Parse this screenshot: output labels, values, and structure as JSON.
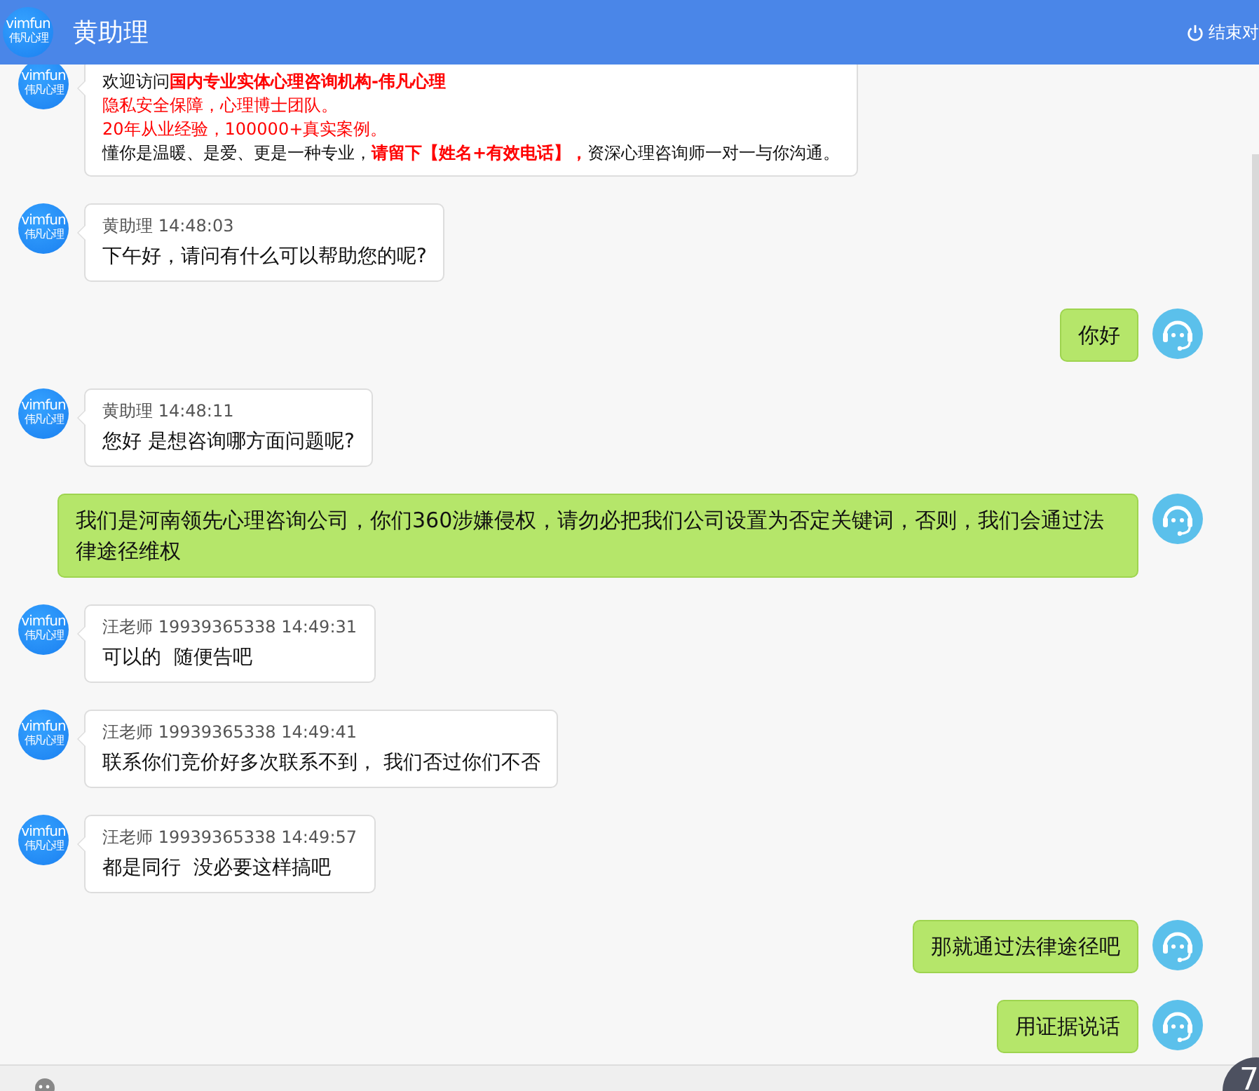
{
  "header": {
    "avatar": {
      "brand": "vimfun",
      "subtitle": "伟凡心理"
    },
    "title": "黄助理",
    "end_button": "结束对"
  },
  "messages": [
    {
      "kind": "agent",
      "avatar": {
        "brand": "vimfun",
        "subtitle": "伟凡心理"
      },
      "lines": [
        [
          {
            "kind": "plain",
            "text": "欢迎访问"
          },
          {
            "kind": "strong",
            "text": "国内专业实体心理咨询机构-伟凡心理"
          }
        ],
        [
          {
            "kind": "notice",
            "text": "隐私安全保障，心理博士团队。"
          }
        ],
        [
          {
            "kind": "notice",
            "text": "20年从业经验，100000+真实案例。"
          }
        ],
        [
          {
            "kind": "plain",
            "text": "懂你是温暖、是爱、更是一种专业，"
          },
          {
            "kind": "strong",
            "text": "请留下【姓名+有效电话】，"
          },
          {
            "kind": "plain",
            "text": "资深心理咨询师一对一与你沟通。"
          }
        ]
      ]
    },
    {
      "kind": "agent",
      "avatar": {
        "brand": "vimfun",
        "subtitle": "伟凡心理"
      },
      "meta": "黄助理 14:48:03",
      "text": "下午好，请问有什么可以帮助您的呢?"
    },
    {
      "kind": "visitor",
      "text": "你好"
    },
    {
      "kind": "agent",
      "avatar": {
        "brand": "vimfun",
        "subtitle": "伟凡心理"
      },
      "meta": "黄助理 14:48:11",
      "text": "您好 是想咨询哪方面问题呢?"
    },
    {
      "kind": "visitor",
      "text": "我们是河南领先心理咨询公司，你们360涉嫌侵权，请勿必把我们公司设置为否定关键词，否则，我们会通过法律途径维权"
    },
    {
      "kind": "agent",
      "avatar": {
        "brand": "vimfun",
        "subtitle": "伟凡心理"
      },
      "meta": "汪老师 19939365338 14:49:31",
      "text": "可以的  随便告吧"
    },
    {
      "kind": "agent",
      "avatar": {
        "brand": "vimfun",
        "subtitle": "伟凡心理"
      },
      "meta": "汪老师 19939365338 14:49:41",
      "text": "联系你们竞价好多次联系不到， 我们否过你们不否"
    },
    {
      "kind": "agent",
      "avatar": {
        "brand": "vimfun",
        "subtitle": "伟凡心理"
      },
      "meta": "汪老师 19939365338 14:49:57",
      "text": "都是同行  没必要这样搞吧"
    },
    {
      "kind": "visitor",
      "text": "那就通过法律途径吧"
    },
    {
      "kind": "visitor",
      "text": "用证据说话"
    }
  ],
  "floating_badge": "7"
}
